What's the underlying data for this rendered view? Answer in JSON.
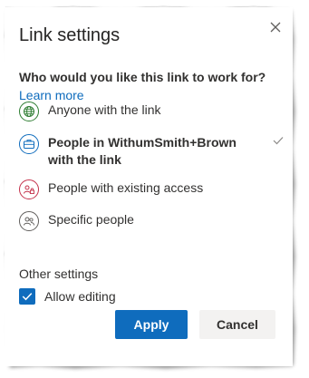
{
  "dialog": {
    "title": "Link settings",
    "close_icon": "close-icon",
    "question": "Who would you like this link to work for?",
    "learn_more": "Learn more",
    "options": [
      {
        "label": "Anyone with the link",
        "icon": "globe-icon",
        "selected": false,
        "icon_color": "#2e7d32"
      },
      {
        "label": "People in WithumSmith+Brown with the link",
        "icon": "briefcase-icon",
        "selected": true,
        "icon_color": "#0f6cbd"
      },
      {
        "label": "People with existing access",
        "icon": "people-lock-icon",
        "selected": false,
        "icon_color": "#c4314b"
      },
      {
        "label": "Specific people",
        "icon": "people-icon",
        "selected": false,
        "icon_color": "#605e5c"
      }
    ],
    "other_settings_title": "Other settings",
    "allow_editing": {
      "label": "Allow editing",
      "checked": true
    },
    "apply_label": "Apply",
    "cancel_label": "Cancel"
  },
  "colors": {
    "accent": "#0f6cbd",
    "text": "#323130"
  }
}
